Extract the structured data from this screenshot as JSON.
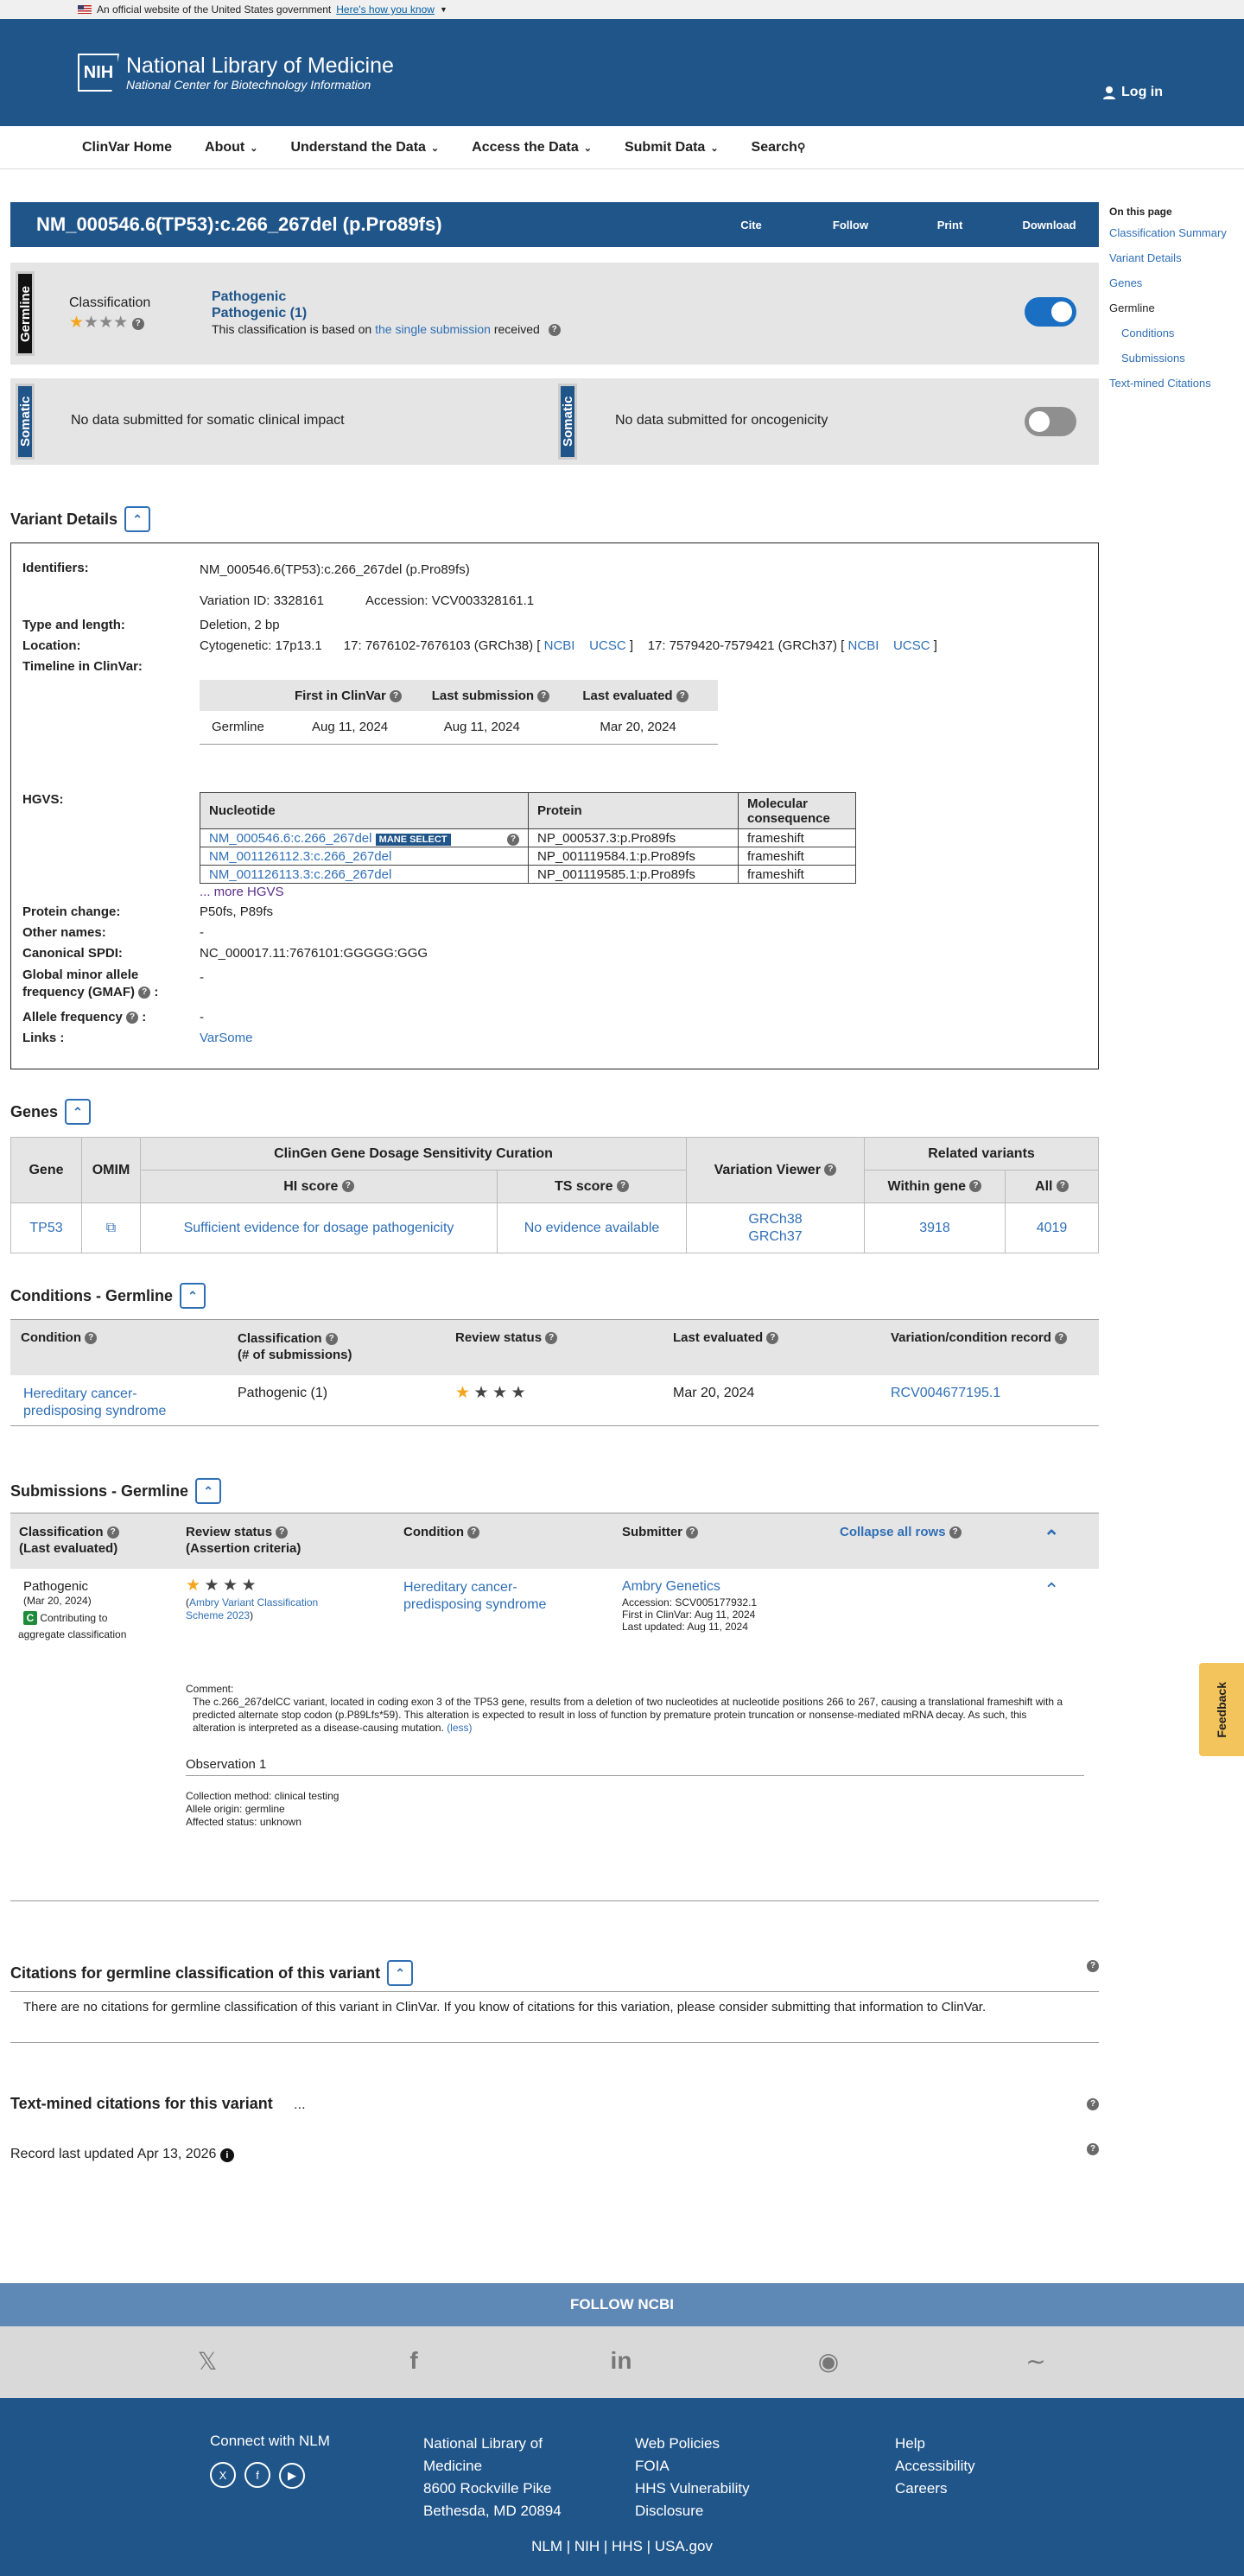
{
  "gov_banner": {
    "text": "An official website of the United States government",
    "link": "Here's how you know"
  },
  "header": {
    "logo_abbr": "NIH",
    "title": "National Library of Medicine",
    "subtitle": "National Center for Biotechnology Information",
    "login": "Log in"
  },
  "nav": [
    "ClinVar Home",
    "About",
    "Understand the Data",
    "Access the Data",
    "Submit Data",
    "Search"
  ],
  "variant": {
    "title": "NM_000546.6(TP53):c.266_267del (p.Pro89fs)",
    "actions": [
      "Cite",
      "Follow",
      "Print",
      "Download"
    ]
  },
  "toc": {
    "heading": "On this page",
    "items": [
      "Classification Summary",
      "Variant Details",
      "Genes",
      "Germline",
      "Conditions",
      "Submissions",
      "Text-mined Citations"
    ]
  },
  "germline": {
    "tag": "Germline",
    "label": "Classification",
    "class1": "Pathogenic",
    "class2": "Pathogenic (1)",
    "based_pre": "This classification is based on",
    "based_link": "the single submission",
    "based_post": "received"
  },
  "somatic": {
    "tag": "Somatic",
    "clinical": "No data submitted for somatic clinical impact",
    "oncogenicity": "No data submitted for oncogenicity"
  },
  "variant_details": {
    "heading": "Variant Details",
    "identifiers_label": "Identifiers:",
    "identifiers": "NM_000546.6(TP53):c.266_267del (p.Pro89fs)",
    "variation_id": "Variation ID: 3328161",
    "accession": "Accession: VCV003328161.1",
    "type_label": "Type and length:",
    "type": "Deletion, 2 bp",
    "location_label": "Location:",
    "cyto": "Cytogenetic: 17p13.1",
    "grch38": "17: 7676102-7676103 (GRCh38) [",
    "ncbi": "NCBI",
    "ucsc": "UCSC",
    "close": "]",
    "grch37": "17: 7579420-7579421 (GRCh37) [",
    "timeline_label": "Timeline in ClinVar:",
    "timeline_headers": [
      "First in ClinVar",
      "Last submission",
      "Last evaluated"
    ],
    "timeline_row": [
      "Germline",
      "Aug 11, 2024",
      "Aug 11, 2024",
      "Mar 20, 2024"
    ],
    "hgvs_label": "HGVS:",
    "hgvs_headers": [
      "Nucleotide",
      "Protein",
      "Molecular consequence"
    ],
    "mane": "MANE SELECT",
    "hgvs_rows": [
      [
        "NM_000546.6:c.266_267del",
        "NP_000537.3:p.Pro89fs",
        "frameshift"
      ],
      [
        "NM_001126112.3:c.266_267del",
        "NP_001119584.1:p.Pro89fs",
        "frameshift"
      ],
      [
        "NM_001126113.3:c.266_267del",
        "NP_001119585.1:p.Pro89fs",
        "frameshift"
      ]
    ],
    "more_hgvs": "... more HGVS",
    "protein_label": "Protein change:",
    "protein": "P50fs, P89fs",
    "other_label": "Other names:",
    "other": "-",
    "spdi_label": "Canonical SPDI:",
    "spdi": "NC_000017.11:7676101:GGGGG:GGG",
    "gmaf_label1": "Global minor allele",
    "gmaf_label2": "frequency (GMAF)",
    "gmaf": "-",
    "af_label": "Allele frequency",
    "af": "-",
    "links_label": "Links :",
    "links": "VarSome"
  },
  "genes": {
    "heading": "Genes",
    "h_gene": "Gene",
    "h_omim": "OMIM",
    "h_clingen": "ClinGen Gene Dosage Sensitivity Curation",
    "h_hi": "HI score",
    "h_ts": "TS score",
    "h_vv": "Variation Viewer",
    "h_related": "Related variants",
    "h_within": "Within gene",
    "h_all": "All",
    "gene": "TP53",
    "hi": "Sufficient evidence for dosage pathogenicity",
    "ts": "No evidence available",
    "grch38": "GRCh38",
    "grch37": "GRCh37",
    "within": "3918",
    "all": "4019"
  },
  "conditions": {
    "heading": "Conditions - Germline",
    "h": [
      "Condition",
      "Classification",
      "(# of submissions)",
      "Review status",
      "Last evaluated",
      "Variation/condition record"
    ],
    "condition1": "Hereditary cancer-",
    "condition2": "predisposing syndrome",
    "classification": "Pathogenic (1)",
    "last": "Mar 20, 2024",
    "record": "RCV004677195.1"
  },
  "submissions": {
    "heading": "Submissions - Germline",
    "h_class1": "Classification",
    "h_class2": "(Last evaluated)",
    "h_review1": "Review status",
    "h_review2": "(Assertion criteria)",
    "h_condition": "Condition",
    "h_submitter": "Submitter",
    "collapse": "Collapse all rows",
    "class": "Pathogenic",
    "date": "(Mar 20, 2024)",
    "c_badge": "C",
    "contrib1": "Contributing to",
    "contrib2": "aggregate classification",
    "criteria1": "Ambry Variant Classification",
    "criteria2": "Scheme 2023",
    "condition1": "Hereditary cancer-",
    "condition2": "predisposing syndrome",
    "submitter": "Ambry Genetics",
    "sub_acc": "Accession: SCV005177932.1",
    "sub_first": "First in ClinVar: Aug 11, 2024",
    "sub_updated": "Last updated: Aug 11, 2024",
    "comment_label": "Comment:",
    "comment": "The c.266_267delCC variant, located in coding exon 3 of the TP53 gene, results from a deletion of two nucleotides at nucleotide positions 266 to 267, causing a translational frameshift with a predicted alternate stop codon (p.P89Lfs*59). This alteration is expected to result in loss of function by premature protein truncation or nonsense-mediated mRNA decay. As such, this alteration is interpreted as a disease-causing mutation.",
    "less": "(less)",
    "obs": "Observation 1",
    "method": "Collection method: clinical testing",
    "origin": "Allele origin: germline",
    "affected": "Affected status: unknown"
  },
  "citations": {
    "heading": "Citations for germline classification of this variant",
    "text": "There are no citations for germline classification of this variant in ClinVar. If you know of citations for this variation, please consider submitting that information to ClinVar."
  },
  "textmined": {
    "heading": "Text-mined citations for this variant",
    "dots": "..."
  },
  "record": "Record last updated Apr 13, 2026",
  "feedback": "Feedback",
  "footer": {
    "follow": "FOLLOW NCBI",
    "connect": "Connect with NLM",
    "nlm1": "National Library of",
    "nlm2": "Medicine",
    "addr1": "8600 Rockville Pike",
    "addr2": "Bethesda, MD 20894",
    "col3": [
      "Web Policies",
      "FOIA",
      "HHS Vulnerability",
      "Disclosure"
    ],
    "col4": [
      "Help",
      "Accessibility",
      "Careers"
    ],
    "bottom": [
      "NLM",
      "NIH",
      "HHS",
      "USA.gov"
    ]
  }
}
